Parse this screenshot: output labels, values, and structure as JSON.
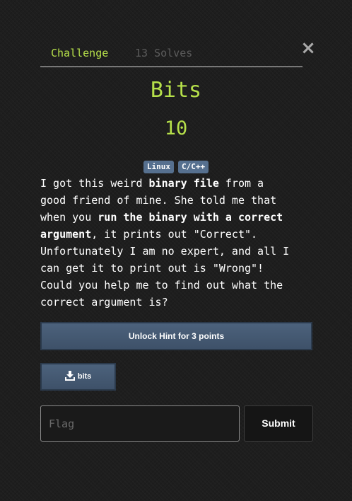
{
  "tabs": {
    "challenge": "Challenge",
    "solves": "13 Solves"
  },
  "close_icon": "×",
  "challenge": {
    "name": "Bits",
    "value": "10",
    "tags": [
      "Linux",
      "C/C++"
    ],
    "description": {
      "p1": "I got this weird ",
      "b1": "binary file",
      "p2": " from a\ngood friend of mine. She told me that\nwhen you ",
      "b2": "run the binary with a correct\nargument",
      "p3": ", it prints out \"Correct\".\nUnfortunately I am no expert, and all I\ncan get it to print out is \"Wrong\"!\nCould you help me to find out what the\ncorrect argument is?"
    }
  },
  "hint_button": "Unlock Hint for 3 points",
  "file": {
    "icon": "download-icon",
    "label": "bits"
  },
  "flag_input": {
    "placeholder": "Flag",
    "value": ""
  },
  "submit_button": "Submit",
  "colors": {
    "accent": "#b6e04a",
    "tag_bg": "#56708f",
    "button_bg": "#46596f"
  }
}
